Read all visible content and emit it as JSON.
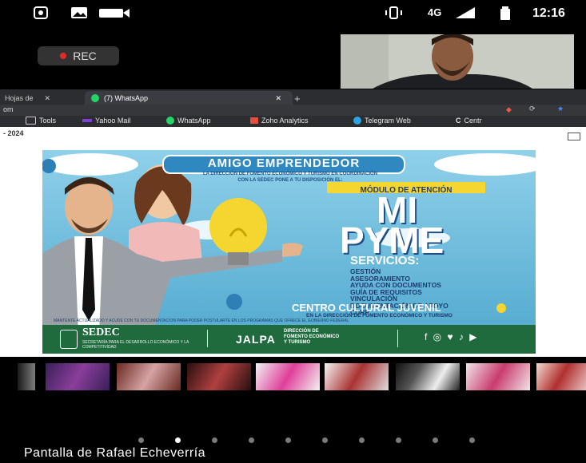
{
  "status_bar": {
    "network": "4G",
    "time": "12:16"
  },
  "recording": {
    "label": "REC"
  },
  "browser": {
    "tabs": [
      {
        "label": "Hojas de",
        "active": false
      },
      {
        "label": "(7) WhatsApp",
        "active": true
      }
    ],
    "new_tab": "+",
    "address_fragment": "om",
    "bookmarks": [
      {
        "label": "Tools",
        "icon": "folder-icon"
      },
      {
        "label": "Yahoo Mail",
        "icon": "yahoo-icon"
      },
      {
        "label": "WhatsApp",
        "icon": "whatsapp-icon"
      },
      {
        "label": "Zoho Analytics",
        "icon": "zoho-icon"
      },
      {
        "label": "Telegram Web",
        "icon": "telegram-icon"
      },
      {
        "label": "Centr",
        "icon": "c-icon"
      }
    ],
    "page_date_fragment": "- 2024"
  },
  "flyer": {
    "header": "AMIGO EMPRENDEDOR",
    "intro_line1": "LA DIRECCIÓN DE FOMENTO ECONÓMICO Y TURISMO EN COORDINACIÓN",
    "intro_line2": "CON LA SEDEC PONE A TU DISPOSICIÓN EL:",
    "module_label": "MÓDULO DE ATENCIÓN",
    "title_line1": "MI",
    "title_line2": "PYME",
    "services_heading": "SERVICIOS:",
    "services": [
      "GESTIÓN",
      "ASESORAMIENTO",
      "AYUDA CON DOCUMENTOS",
      "GUÍA DE REQUISITOS",
      "VINCULACIÓN",
      "DOCUMENTACIÓN DE APOYO",
      "CURP"
    ],
    "location_title": "CENTRO CULTURAL JUVENIL",
    "location_sub": "EN LA DIRECCIÓN DE FOMENTO ECONÓMICO Y TURISMO",
    "footer_note": "MANTENTE ACTUALIZADO Y ACUDE CON TU DOCUMENTACIÓN PARA PODER POSTULARTE EN LOS PROGRAMAS QUE OFRECE EL GOBIERNO FEDERAL",
    "sedec_name": "SEDEC",
    "sedec_sub": "SECRETARÍA PARA EL DESARROLLO ECONÓMICO Y LA COMPETITIVIDAD",
    "jalpa": "JALPA",
    "direccion_line1": "DIRECCIÓN DE",
    "direccion_line2": "FOMENTO ECONÓMICO",
    "direccion_line3": "Y TURISMO",
    "social_icons": "f ◎ ♥ ♪ ▶"
  },
  "thumbnails_count": 9,
  "pager": {
    "total": 10,
    "active_index": 1
  },
  "caption": "Pantalla de Rafael Echeverría"
}
